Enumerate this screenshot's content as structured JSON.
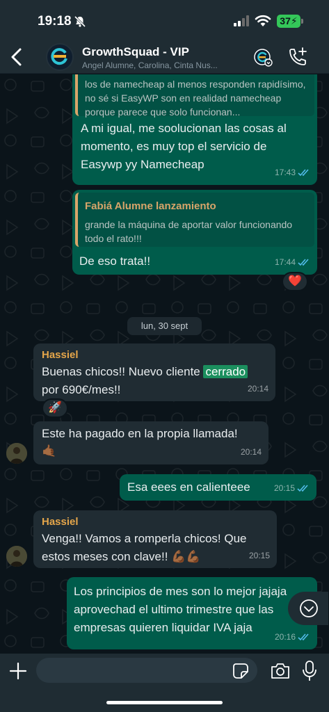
{
  "status": {
    "time": "19:18",
    "battery": "37"
  },
  "header": {
    "group_name": "GrowthSquad - VIP",
    "members": "Angel Alumne, Carolina, Cinta Nus..."
  },
  "messages": {
    "m1": {
      "quote_text": "los de namecheap al menos responden rapidísimo, no sé si EasyWP son en realidad namecheap porque parece que solo funcionan...",
      "text": "A mi igual, me soolucionan las cosas al momento, es muy top el servicio de Easywp yy Namecheap",
      "time": "17:43"
    },
    "m2": {
      "quote_name": "Fabiá Alumne lanzamiento",
      "quote_text": "grande la máquina de aportar valor funcionando todo el rato!!!",
      "text": "De eso trata!!",
      "time": "17:44",
      "reaction": "❤️"
    },
    "date_separator": "lun, 30 sept",
    "m3": {
      "sender": "Hassiel",
      "text_before": "Buenas chicos!! Nuevo cliente ",
      "highlight": "cerrado",
      "text_after": "por 690€/mes!!",
      "time": "20:14",
      "reaction": "🚀"
    },
    "m4": {
      "text": "Este ha pagado en la propia llamada!",
      "emoji": "🤙🏾",
      "time": "20:14"
    },
    "m5": {
      "text": "Esa eees en calienteee",
      "time": "20:15"
    },
    "m6": {
      "sender": "Hassiel",
      "text": "Venga!! Vamos a romperla chicos! Que estos meses con clave!! ",
      "emoji": "💪🏾💪🏾",
      "time": "20:15"
    },
    "m7": {
      "text": "Los principios de mes son lo mejor jajaja aprovechad el ultimo trimestre que las empresas quieren liquidar IVA jaja",
      "time": "20:16"
    }
  },
  "input": {
    "placeholder": ""
  },
  "colors": {
    "outgoing": "#005c4b",
    "incoming": "#202c33",
    "background": "#0b141a",
    "read_ticks": "#53bdeb",
    "sender_name": "#e5a64a"
  }
}
